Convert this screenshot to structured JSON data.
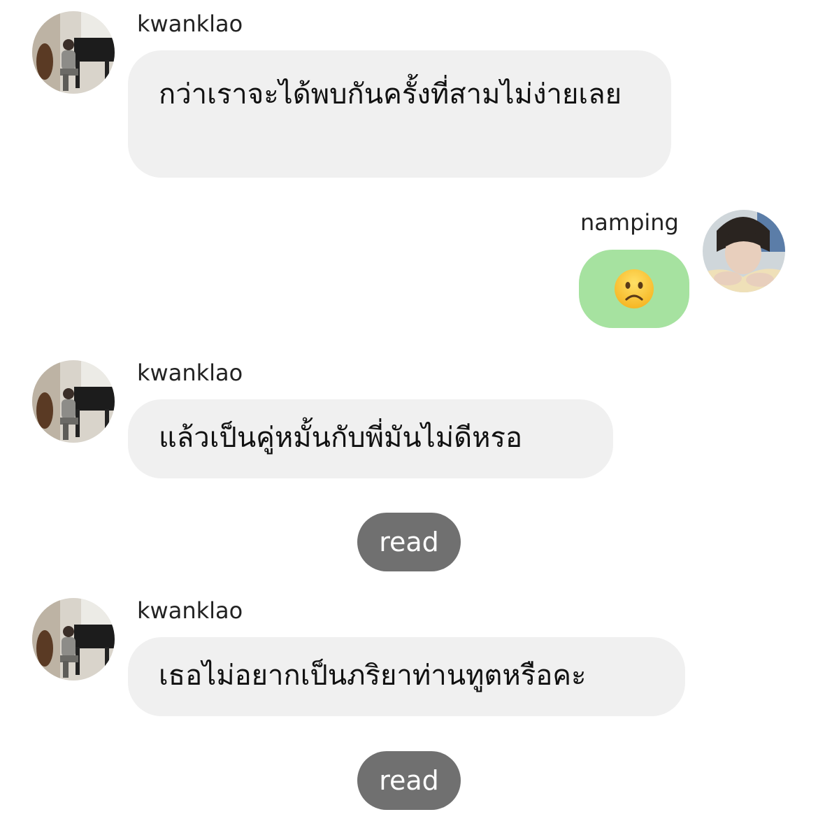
{
  "messages": [
    {
      "sender": "kwanklao",
      "side": "left",
      "avatar": "pianist-avatar",
      "text": "กว่าเราจะได้พบกันครั้งที่สามไม่ง่ายเลย"
    },
    {
      "sender": "namping",
      "side": "right",
      "avatar": "portrait-avatar",
      "emoji": "☹",
      "emoji_name": "frowning-face-icon"
    },
    {
      "sender": "kwanklao",
      "side": "left",
      "avatar": "pianist-avatar",
      "text": "แล้วเป็นคู่หมั้นกับพี่มันไม่ดีหรอ"
    },
    {
      "status": "read"
    },
    {
      "sender": "kwanklao",
      "side": "left",
      "avatar": "pianist-avatar",
      "text": "เธอไม่อยากเป็นภริยาท่านทูตหรือคะ"
    },
    {
      "status": "read"
    }
  ],
  "colors": {
    "incoming_bubble": "#f0f0f0",
    "outgoing_bubble": "#a6e2a0",
    "read_pill": "#707070"
  }
}
